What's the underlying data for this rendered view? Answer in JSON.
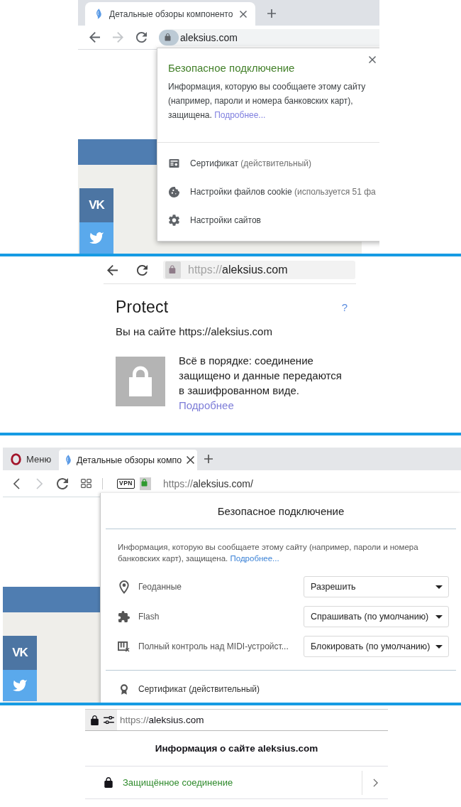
{
  "panels": [
    {
      "kind": "chrome",
      "tabs": [
        {
          "title": "Детальные обзоры компоненто",
          "selected": true
        }
      ],
      "back_button": {
        "disabled": false
      },
      "forward_button": {
        "disabled": true
      },
      "address": {
        "host": "aleksius.com"
      },
      "page": {
        "share_buttons": [
          {
            "kind": "text",
            "label": "VK"
          },
          {
            "kind": "bird"
          }
        ]
      },
      "popup": {
        "title": "Безопасное подключение",
        "text": "Информация, которую вы сообщаете этому сайту (например, пароли и номера банковских карт), защищена.",
        "link": "Подробнее...",
        "items": [
          {
            "label": "Сертификат",
            "note": "(действительный)"
          },
          {
            "label": "Настройки файлов cookie",
            "note": "(используется 51 фа"
          },
          {
            "label": "Настройки сайтов"
          }
        ]
      }
    },
    {
      "kind": "yandex",
      "back_button": {
        "disabled": false
      },
      "address": {
        "scheme": "https://",
        "host": "aleksius.com"
      },
      "popup": {
        "title": "Protect",
        "help": "?",
        "site_line": "Вы на сайте https://aleksius.com",
        "status": "Всё в порядке: соединение защищено и данные передаются в зашифрованном виде.",
        "link": "Подробнее"
      }
    },
    {
      "kind": "opera",
      "menu_label": "Меню",
      "tabs": [
        {
          "title": "Детальные обзоры компо",
          "selected": true
        }
      ],
      "back_button": {
        "disabled": false
      },
      "forward_button": {
        "disabled": true
      },
      "vpn_label": "VPN",
      "address": {
        "scheme": "https://",
        "host": "aleksius.com/"
      },
      "page": {
        "share_buttons": [
          {
            "kind": "text",
            "label": "VK"
          },
          {
            "kind": "bird"
          }
        ]
      },
      "popup": {
        "title": "Безопасное подключение",
        "text": "Информация, которую вы сообщаете этому сайту (например, пароли и номера банковских карт), защищена.",
        "link": "Подробнее...",
        "permissions": [
          {
            "label": "Геоданные",
            "value": "Разрешить"
          },
          {
            "label": "Flash",
            "value": "Спрашивать (по умолчанию)"
          },
          {
            "label": "Полный контроль над MIDI-устройст...",
            "value": "Блокировать (по умолчанию)"
          }
        ],
        "certificate": "Сертификат (действительный)"
      }
    },
    {
      "kind": "firefox",
      "address": {
        "scheme": "https://",
        "host": "aleksius.com"
      },
      "popup": {
        "title": "Информация о сайте aleksius.com",
        "items": [
          {
            "label": "Защищённое соединение"
          }
        ]
      }
    }
  ]
}
